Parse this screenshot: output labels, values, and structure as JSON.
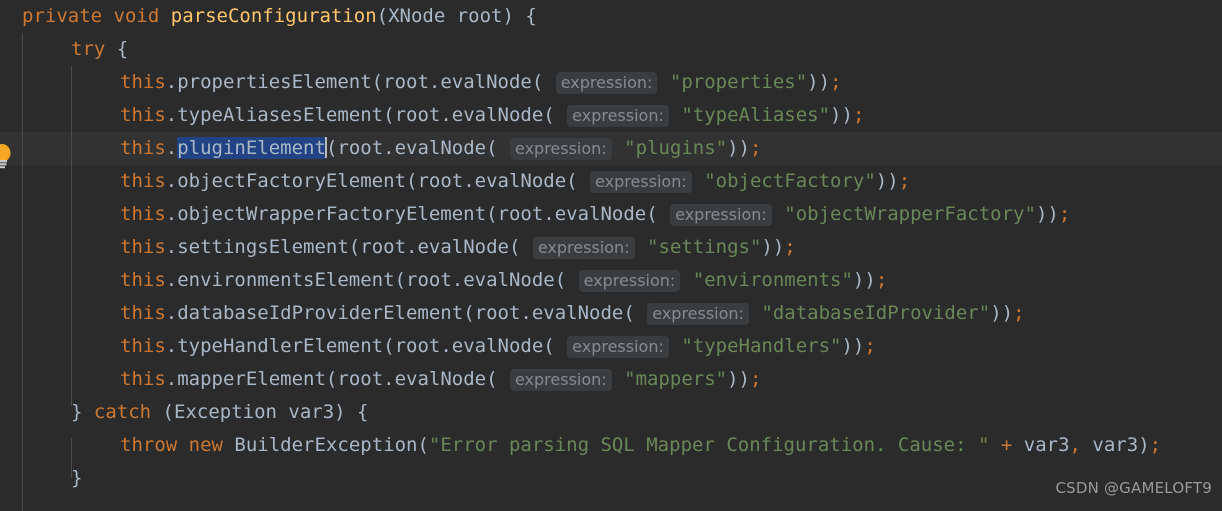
{
  "editor": {
    "theme": "darcula",
    "background": "#2b2b2b",
    "current_line_background": "#323232",
    "default_text_color": "#a9b7c6",
    "keyword_color": "#cc7832",
    "string_color": "#6a8759",
    "method_decl_color": "#ffc66d",
    "selection_color": "#214283",
    "inlay_hint_color": "#868a91",
    "inlay_hint_background": "#3a3d3f",
    "indent_guide_color": "#4b4b4b"
  },
  "gutter": {
    "lightbulb_icon": "lightbulb-intention-icon",
    "lightbulb_color": "#f5a623"
  },
  "code": {
    "top_partial_glyph": "}",
    "highlighted_line_index": 4,
    "language": "java",
    "lines": [
      {
        "indent": 0,
        "tokens": [
          {
            "t": "kw",
            "v": "private"
          },
          {
            "t": "id",
            "v": " "
          },
          {
            "t": "kw",
            "v": "void"
          },
          {
            "t": "id",
            "v": " "
          },
          {
            "t": "mdecl",
            "v": "parseConfiguration"
          },
          {
            "t": "paren",
            "v": "("
          },
          {
            "t": "id",
            "v": "XNode root"
          },
          {
            "t": "paren",
            "v": ")"
          },
          {
            "t": "id",
            "v": " {"
          }
        ]
      },
      {
        "indent": 1,
        "tokens": [
          {
            "t": "kw",
            "v": "try"
          },
          {
            "t": "id",
            "v": " {"
          }
        ]
      },
      {
        "indent": 2,
        "tokens": [
          {
            "t": "kw",
            "v": "this"
          },
          {
            "t": "id",
            "v": ".propertiesElement"
          },
          {
            "t": "paren",
            "v": "("
          },
          {
            "t": "id",
            "v": "root.evalNode"
          },
          {
            "t": "paren",
            "v": "( "
          },
          {
            "t": "hint",
            "v": "expression:"
          },
          {
            "t": "id",
            "v": " "
          },
          {
            "t": "str",
            "v": "\"properties\""
          },
          {
            "t": "paren",
            "v": "))"
          },
          {
            "t": "semi",
            "v": ";"
          }
        ]
      },
      {
        "indent": 2,
        "tokens": [
          {
            "t": "kw",
            "v": "this"
          },
          {
            "t": "id",
            "v": ".typeAliasesElement"
          },
          {
            "t": "paren",
            "v": "("
          },
          {
            "t": "id",
            "v": "root.evalNode"
          },
          {
            "t": "paren",
            "v": "( "
          },
          {
            "t": "hint",
            "v": "expression:"
          },
          {
            "t": "id",
            "v": " "
          },
          {
            "t": "str",
            "v": "\"typeAliases\""
          },
          {
            "t": "paren",
            "v": "))"
          },
          {
            "t": "semi",
            "v": ";"
          }
        ]
      },
      {
        "indent": 2,
        "tokens": [
          {
            "t": "kw",
            "v": "this"
          },
          {
            "t": "id",
            "v": "."
          },
          {
            "t": "sel",
            "v": "pluginElement"
          },
          {
            "t": "caret",
            "v": ""
          },
          {
            "t": "paren",
            "v": "("
          },
          {
            "t": "id",
            "v": "root.evalNode"
          },
          {
            "t": "paren",
            "v": "( "
          },
          {
            "t": "hint",
            "v": "expression:"
          },
          {
            "t": "id",
            "v": " "
          },
          {
            "t": "str",
            "v": "\"plugins\""
          },
          {
            "t": "paren",
            "v": "))"
          },
          {
            "t": "semi",
            "v": ";"
          }
        ]
      },
      {
        "indent": 2,
        "tokens": [
          {
            "t": "kw",
            "v": "this"
          },
          {
            "t": "id",
            "v": ".objectFactoryElement"
          },
          {
            "t": "paren",
            "v": "("
          },
          {
            "t": "id",
            "v": "root.evalNode"
          },
          {
            "t": "paren",
            "v": "( "
          },
          {
            "t": "hint",
            "v": "expression:"
          },
          {
            "t": "id",
            "v": " "
          },
          {
            "t": "str",
            "v": "\"objectFactory\""
          },
          {
            "t": "paren",
            "v": "))"
          },
          {
            "t": "semi",
            "v": ";"
          }
        ]
      },
      {
        "indent": 2,
        "tokens": [
          {
            "t": "kw",
            "v": "this"
          },
          {
            "t": "id",
            "v": ".objectWrapperFactoryElement"
          },
          {
            "t": "paren",
            "v": "("
          },
          {
            "t": "id",
            "v": "root.evalNode"
          },
          {
            "t": "paren",
            "v": "( "
          },
          {
            "t": "hint",
            "v": "expression:"
          },
          {
            "t": "id",
            "v": " "
          },
          {
            "t": "str",
            "v": "\"objectWrapperFactory\""
          },
          {
            "t": "paren",
            "v": "))"
          },
          {
            "t": "semi",
            "v": ";"
          }
        ]
      },
      {
        "indent": 2,
        "tokens": [
          {
            "t": "kw",
            "v": "this"
          },
          {
            "t": "id",
            "v": ".settingsElement"
          },
          {
            "t": "paren",
            "v": "("
          },
          {
            "t": "id",
            "v": "root.evalNode"
          },
          {
            "t": "paren",
            "v": "( "
          },
          {
            "t": "hint",
            "v": "expression:"
          },
          {
            "t": "id",
            "v": " "
          },
          {
            "t": "str",
            "v": "\"settings\""
          },
          {
            "t": "paren",
            "v": "))"
          },
          {
            "t": "semi",
            "v": ";"
          }
        ]
      },
      {
        "indent": 2,
        "tokens": [
          {
            "t": "kw",
            "v": "this"
          },
          {
            "t": "id",
            "v": ".environmentsElement"
          },
          {
            "t": "paren",
            "v": "("
          },
          {
            "t": "id",
            "v": "root.evalNode"
          },
          {
            "t": "paren",
            "v": "( "
          },
          {
            "t": "hint",
            "v": "expression:"
          },
          {
            "t": "id",
            "v": " "
          },
          {
            "t": "str",
            "v": "\"environments\""
          },
          {
            "t": "paren",
            "v": "))"
          },
          {
            "t": "semi",
            "v": ";"
          }
        ]
      },
      {
        "indent": 2,
        "tokens": [
          {
            "t": "kw",
            "v": "this"
          },
          {
            "t": "id",
            "v": ".databaseIdProviderElement"
          },
          {
            "t": "paren",
            "v": "("
          },
          {
            "t": "id",
            "v": "root.evalNode"
          },
          {
            "t": "paren",
            "v": "( "
          },
          {
            "t": "hint",
            "v": "expression:"
          },
          {
            "t": "id",
            "v": " "
          },
          {
            "t": "str",
            "v": "\"databaseIdProvider\""
          },
          {
            "t": "paren",
            "v": "))"
          },
          {
            "t": "semi",
            "v": ";"
          }
        ]
      },
      {
        "indent": 2,
        "tokens": [
          {
            "t": "kw",
            "v": "this"
          },
          {
            "t": "id",
            "v": ".typeHandlerElement"
          },
          {
            "t": "paren",
            "v": "("
          },
          {
            "t": "id",
            "v": "root.evalNode"
          },
          {
            "t": "paren",
            "v": "( "
          },
          {
            "t": "hint",
            "v": "expression:"
          },
          {
            "t": "id",
            "v": " "
          },
          {
            "t": "str",
            "v": "\"typeHandlers\""
          },
          {
            "t": "paren",
            "v": "))"
          },
          {
            "t": "semi",
            "v": ";"
          }
        ]
      },
      {
        "indent": 2,
        "tokens": [
          {
            "t": "kw",
            "v": "this"
          },
          {
            "t": "id",
            "v": ".mapperElement"
          },
          {
            "t": "paren",
            "v": "("
          },
          {
            "t": "id",
            "v": "root.evalNode"
          },
          {
            "t": "paren",
            "v": "( "
          },
          {
            "t": "hint",
            "v": "expression:"
          },
          {
            "t": "id",
            "v": " "
          },
          {
            "t": "str",
            "v": "\"mappers\""
          },
          {
            "t": "paren",
            "v": "))"
          },
          {
            "t": "semi",
            "v": ";"
          }
        ]
      },
      {
        "indent": 1,
        "tokens": [
          {
            "t": "id",
            "v": "} "
          },
          {
            "t": "kw",
            "v": "catch"
          },
          {
            "t": "id",
            "v": " "
          },
          {
            "t": "paren",
            "v": "("
          },
          {
            "t": "id",
            "v": "Exception var3"
          },
          {
            "t": "paren",
            "v": ")"
          },
          {
            "t": "id",
            "v": " {"
          }
        ]
      },
      {
        "indent": 2,
        "tokens": [
          {
            "t": "kw",
            "v": "throw"
          },
          {
            "t": "id",
            "v": " "
          },
          {
            "t": "kw",
            "v": "new"
          },
          {
            "t": "id",
            "v": " BuilderException"
          },
          {
            "t": "paren",
            "v": "("
          },
          {
            "t": "str",
            "v": "\"Error parsing SQL Mapper Configuration. Cause: \""
          },
          {
            "t": "id",
            "v": " "
          },
          {
            "t": "semi",
            "v": "+"
          },
          {
            "t": "id",
            "v": " var3"
          },
          {
            "t": "semi",
            "v": ","
          },
          {
            "t": "id",
            "v": " var3"
          },
          {
            "t": "paren",
            "v": ")"
          },
          {
            "t": "semi",
            "v": ";"
          }
        ]
      },
      {
        "indent": 1,
        "tokens": [
          {
            "t": "id",
            "v": "}"
          }
        ]
      }
    ]
  },
  "watermark": {
    "text": "CSDN @GAMELOFT9"
  }
}
